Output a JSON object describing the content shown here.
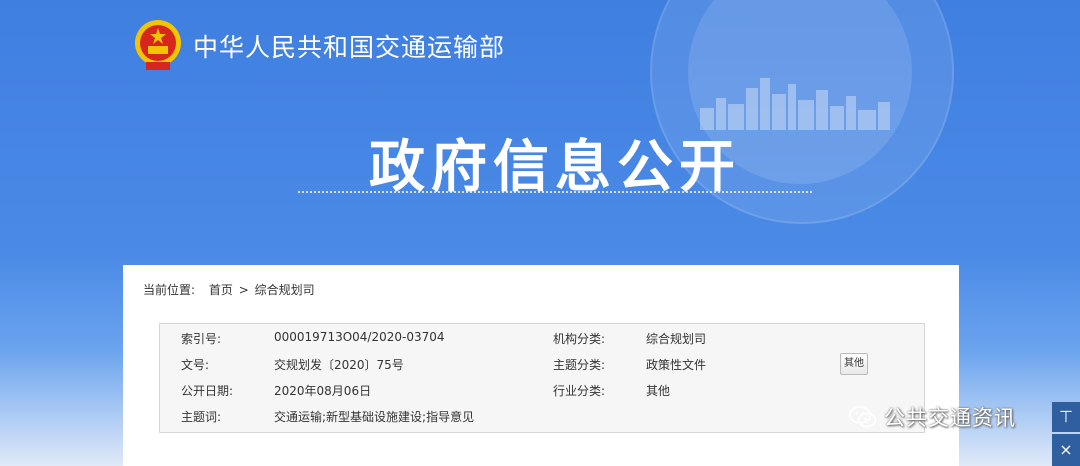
{
  "header": {
    "ministry_name": "中华人民共和国交通运输部",
    "hero_title": "政府信息公开"
  },
  "breadcrumb": {
    "label": "当前位置:",
    "home": "首页",
    "separator": ">",
    "current": "综合规划司"
  },
  "info": {
    "rows": [
      {
        "label1": "索引号:",
        "value1": "000019713O04/2020-03704",
        "label2": "机构分类:",
        "value2": "综合规划司"
      },
      {
        "label1": "文号:",
        "value1": "交规划发〔2020〕75号",
        "label2": "主题分类:",
        "value2": "政策性文件"
      },
      {
        "label1": "公开日期:",
        "value1": "2020年08月06日",
        "label2": "行业分类:",
        "value2": "其他"
      },
      {
        "label1": "主题词:",
        "value1": "交通运输;新型基础设施建设;指导意见",
        "label2": "",
        "value2": ""
      }
    ],
    "other_button": "其他"
  },
  "watermark": {
    "text": "公共交通资讯",
    "icon": "wechat-icon"
  },
  "side_buttons": {
    "top_label": "⊤",
    "close_label": "×"
  },
  "colors": {
    "hero_blue": "#4b8ae6",
    "side_button": "#2f5f9e",
    "emblem_red": "#d7261e",
    "emblem_gold": "#f5c400"
  }
}
